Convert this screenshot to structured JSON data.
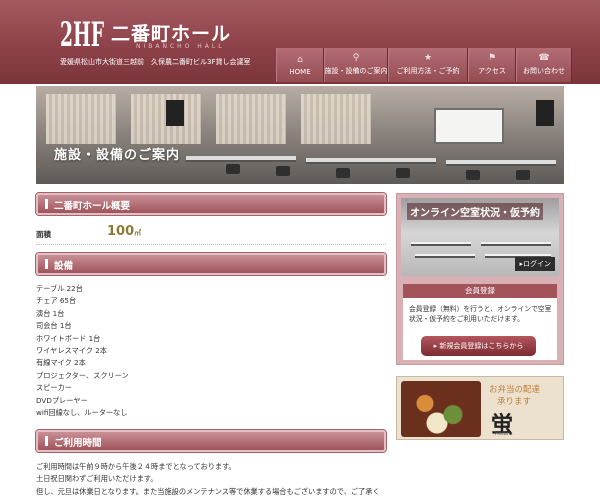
{
  "header": {
    "logo_mark": "2HF",
    "title": "二番町ホール",
    "subtitle": "NIBANCHO HALL",
    "address": "愛媛県松山市大街道三越前　久保農二番町ビル3F貸し会議室"
  },
  "nav": {
    "items": [
      {
        "label": "HOME",
        "icon": "home-icon"
      },
      {
        "label": "施設・設備のご案内",
        "icon": "search-icon"
      },
      {
        "label": "ご利用方法・ご予約",
        "icon": "star-icon"
      },
      {
        "label": "アクセス",
        "icon": "flag-icon"
      },
      {
        "label": "お問い合わせ",
        "icon": "phone-icon"
      }
    ]
  },
  "hero": {
    "title": "施設・設備のご案内"
  },
  "overview": {
    "heading": "二番町ホール概要",
    "area_label": "面積",
    "area_value": "100",
    "area_unit": "㎡"
  },
  "equipment": {
    "heading": "設備",
    "items": [
      "テーブル 22台",
      "チェア 65台",
      "演台 1台",
      "司会台 1台",
      "ホワイトボード 1台",
      "ワイヤレスマイク 2本",
      "有線マイク 2本",
      "プロジェクター、スクリーン",
      "スピーカー",
      "DVDプレーヤー",
      "wifi回線なし、ルーターなし"
    ]
  },
  "hours": {
    "heading": "ご利用時間",
    "lines": [
      "ご利用時間は午前９時から午後２４時までとなっております。",
      "土日祝日関わずご利用いただけます。",
      "但し、元旦は休業日となります。また当施設のメンテナンス等で休業する場合もございますので、ご了承く"
    ]
  },
  "sidebar": {
    "online_title": "オンライン空室状況・仮予約",
    "login_label": "▸ログイン",
    "member_heading": "会員登録",
    "member_text": "会員登録（無料）を行うと、オンラインで空室状況・仮予約をご利用いただけます。",
    "register_label": "▸ 新規会員登録はこちらから",
    "bento_title": "お弁当の配達",
    "bento_sub": "承ります",
    "bento_brand": "蛍",
    "bento_roman": "Hotaru"
  },
  "colors": {
    "brand": "#8e4249",
    "accent_gold": "#8d7a36"
  }
}
